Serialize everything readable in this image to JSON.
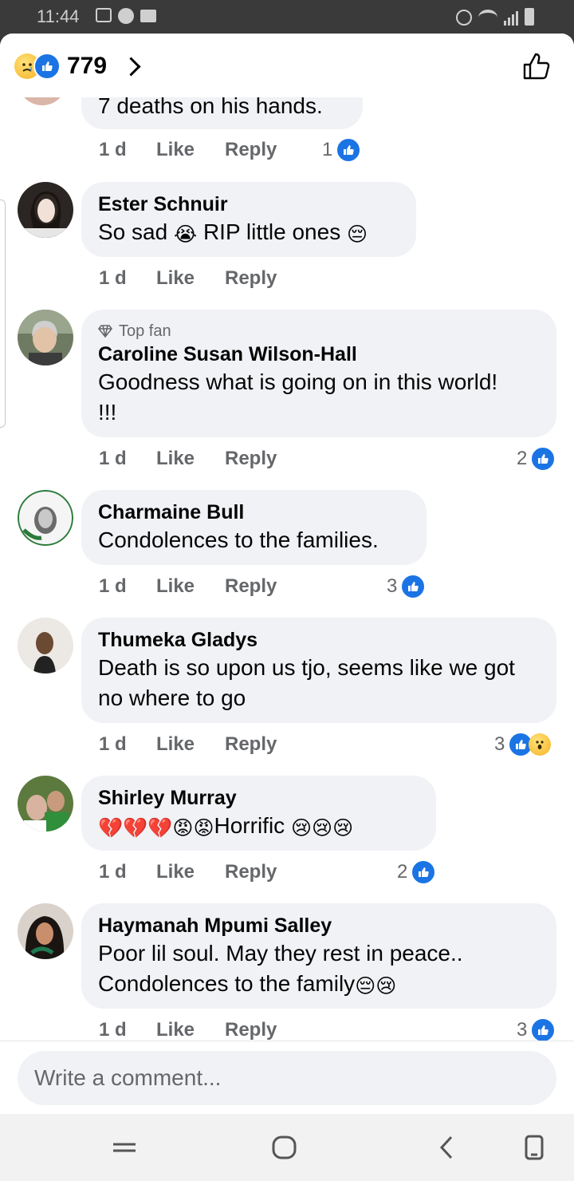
{
  "status_bar": {
    "time": "11:44"
  },
  "header": {
    "reaction_count": "779"
  },
  "comments": [
    {
      "partial": true,
      "text": "7 deaths on his hands.",
      "time": "1 d",
      "like": "Like",
      "reply": "Reply",
      "reaction_count": "1"
    },
    {
      "name": "Ester Schnuir",
      "text_before": "So sad ",
      "emoji1": "😭",
      "text_middle": " RIP little ones ",
      "emoji2": "😔",
      "time": "1 d",
      "like": "Like",
      "reply": "Reply"
    },
    {
      "badge": "Top fan",
      "name": "Caroline Susan Wilson-Hall",
      "text": "Goodness what is going on in this world! !!!",
      "time": "1 d",
      "like": "Like",
      "reply": "Reply",
      "reaction_count": "2"
    },
    {
      "name": "Charmaine Bull",
      "text": "Condolences to the families.",
      "time": "1 d",
      "like": "Like",
      "reply": "Reply",
      "reaction_count": "3"
    },
    {
      "name": "Thumeka Gladys",
      "text": "Death is so upon us tjo, seems like we got no where to go",
      "time": "1 d",
      "like": "Like",
      "reply": "Reply",
      "reaction_count": "3"
    },
    {
      "name": "Shirley Murray",
      "emoji_prefix": "💔💔💔😡😡",
      "text": "Horrific ",
      "emoji_suffix": "😢😢😢",
      "time": "1 d",
      "like": "Like",
      "reply": "Reply",
      "reaction_count": "2"
    },
    {
      "name": "Haymanah Mpumi Salley",
      "text_line1": "Poor lil soul.  May they rest in peace..",
      "text_line2": "Condolences to the family",
      "emoji_suffix": "😔😢",
      "time": "1 d",
      "like": "Like",
      "reply": "Reply",
      "reaction_count": "3"
    }
  ],
  "composer": {
    "placeholder": "Write a comment..."
  },
  "colors": {
    "accent": "#1b74e4",
    "bubble": "#f0f2f5",
    "muted": "#65676b"
  },
  "icons": [
    "sad-reaction-icon",
    "like-reaction-icon",
    "wow-reaction-icon",
    "chevron-right-icon",
    "thumbs-up-outline-icon",
    "diamond-icon",
    "menu-nav-icon",
    "home-nav-icon",
    "back-nav-icon",
    "recents-nav-icon"
  ]
}
